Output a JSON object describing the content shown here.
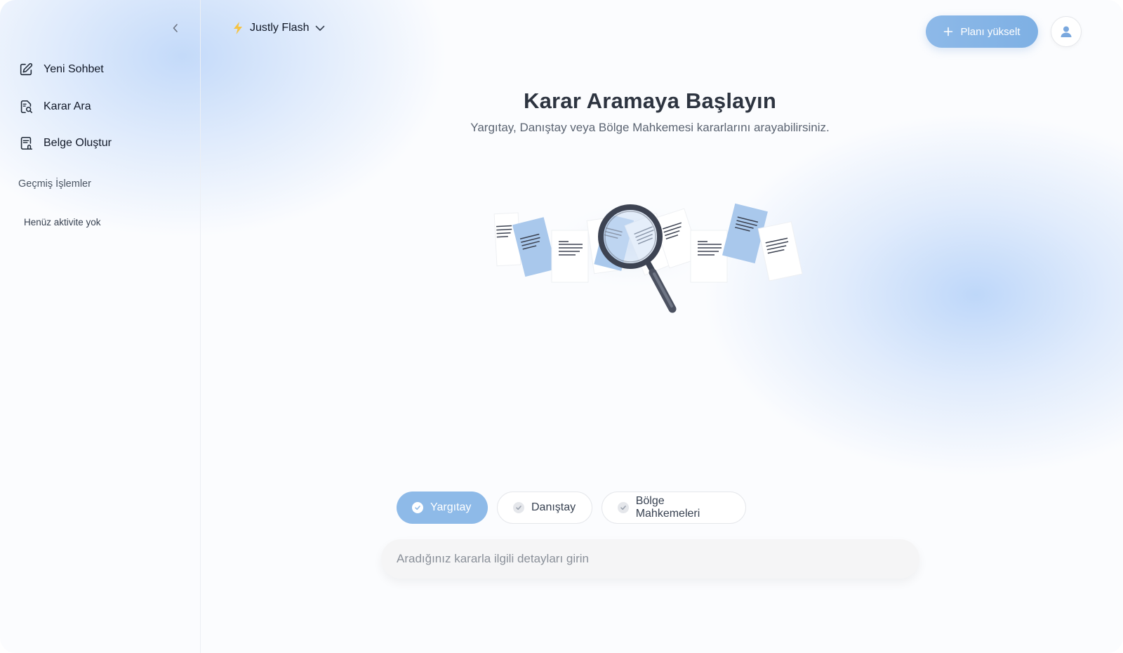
{
  "sidebar": {
    "nav": [
      {
        "label": "Yeni Sohbet",
        "icon": "edit-icon"
      },
      {
        "label": "Karar Ara",
        "icon": "document-search-icon"
      },
      {
        "label": "Belge Oluştur",
        "icon": "document-create-icon"
      }
    ],
    "history_title": "Geçmiş İşlemler",
    "history_empty": "Henüz aktivite yok"
  },
  "header": {
    "model_name": "Justly Flash",
    "upgrade_label": "Planı yükselt"
  },
  "hero": {
    "title": "Karar Aramaya Başlayın",
    "subtitle": "Yargıtay, Danıştay veya Bölge Mahkemesi kararlarını arayabilirsiniz."
  },
  "filters": [
    {
      "label": "Yargıtay",
      "selected": true
    },
    {
      "label": "Danıştay",
      "selected": false
    },
    {
      "label": "Bölge Mahkemeleri",
      "selected": false
    }
  ],
  "search": {
    "placeholder": "Aradığınız kararla ilgili detayları girin",
    "value": ""
  },
  "colors": {
    "accent": "#8ebae8",
    "bolt": "#f6c343",
    "doc_blue": "#a9c8ec"
  }
}
